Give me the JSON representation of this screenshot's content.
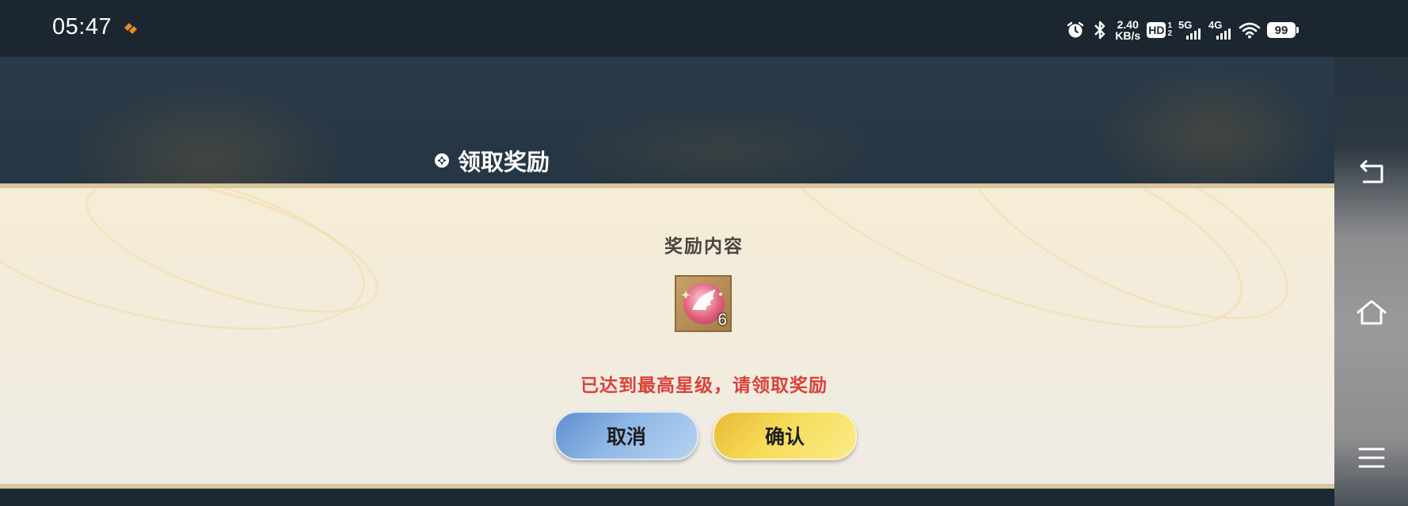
{
  "status_bar": {
    "time": "05:47",
    "net_speed_value": "2.40",
    "net_speed_unit": "KB/s",
    "hd_label": "HD",
    "sim1_label": "5G",
    "sim2_label": "4G",
    "battery_level": "99",
    "icons": [
      "app-notification-icon",
      "alarm-icon",
      "bluetooth-icon",
      "hd-volte-icon",
      "cellular-5g-icon",
      "cellular-4g-icon",
      "wifi-icon",
      "battery-icon"
    ]
  },
  "game": {
    "header_title": "领取奖励",
    "header_icon": "reward-badge-icon"
  },
  "dialog": {
    "reward_label": "奖励内容",
    "reward_item": {
      "icon": "winged-orb-item-icon",
      "count": "6"
    },
    "notice": "已达到最高星级，请领取奖励",
    "cancel_label": "取消",
    "confirm_label": "确认",
    "colors": {
      "notice": "#d9423a",
      "cancel_button": "#8fb7e6",
      "confirm_button": "#f6dc5a"
    }
  },
  "nav_bar": {
    "buttons": [
      "back-icon",
      "home-icon",
      "menu-icon"
    ]
  }
}
